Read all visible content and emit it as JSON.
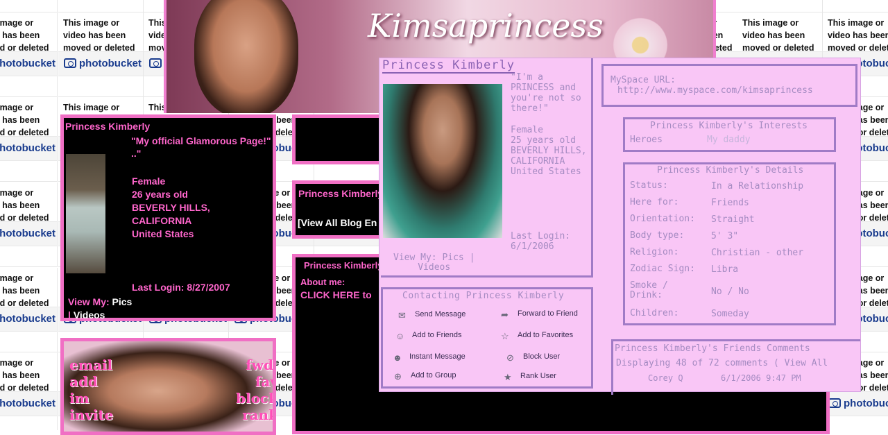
{
  "background": {
    "tile_text": "This image or video has been moved or deleted",
    "logo_text": "photobucket"
  },
  "banner": {
    "title": "Kimsaprincess"
  },
  "left_profile": {
    "name": "Princess Kimberly",
    "quote": "\"My official Glamorous Page!\"",
    "quote_extra": "..\"",
    "gender": "Female",
    "age": "26 years old",
    "city": "BEVERLY HILLS,",
    "state": "CALIFORNIA",
    "country": "United States",
    "last_login": "Last Login: 8/27/2007",
    "view_my": "View My:",
    "pics": "Pics",
    "videos": "Videos"
  },
  "collage": {
    "left_words": [
      "email",
      "add",
      "im",
      "invite"
    ],
    "right_words": [
      "fwd.",
      "fav",
      "block",
      "rank"
    ]
  },
  "mid": {
    "blog_name": "Princess Kimberly",
    "view_blog": "[View All Blog En",
    "about_name": "Princess Kimberly'",
    "about_me": "About me:",
    "click_here": "CLICK HERE to"
  },
  "panel": {
    "name": "Princess Kimberly",
    "quote": "\"I'm a PRINCESS and you're not so there!\"",
    "gender": "Female",
    "age": "25 years old",
    "location": "BEVERLY HILLS, CALIFORNIA United States",
    "last_login_label": "Last Login:",
    "last_login_date": "6/1/2006",
    "view_my": "View My: Pics |",
    "videos": "Videos",
    "myspace_url_label": "MySpace URL:",
    "myspace_url": "http://www.myspace.com/kimsaprincess",
    "contact_header": "Contacting Princess Kimberly",
    "actions": {
      "send_message": "Send Message",
      "forward": "Forward to Friend",
      "add_friends": "Add to Friends",
      "add_favorites": "Add to Favorites",
      "instant_message": "Instant Message",
      "block_user": "Block User",
      "add_group": "Add to Group",
      "rank_user": "Rank User"
    },
    "interests_header": "Princess Kimberly's Interests",
    "heroes_label": "Heroes",
    "heroes_value": "My daddy",
    "details_header": "Princess Kimberly's Details",
    "details": [
      {
        "k": "Status:",
        "v": "In a Relationship"
      },
      {
        "k": "Here for:",
        "v": "Friends"
      },
      {
        "k": "Orientation:",
        "v": "Straight"
      },
      {
        "k": "Body type:",
        "v": "5' 3\""
      },
      {
        "k": "Religion:",
        "v": "Christian - other"
      },
      {
        "k": "Zodiac Sign:",
        "v": "Libra"
      },
      {
        "k": "Smoke / Drink:",
        "v": "No / No"
      },
      {
        "k": "Children:",
        "v": "Someday"
      }
    ],
    "friends_header": "Princess Kimberly's Friends Comments",
    "displaying": "Displaying 48 of 72 comments  ( View All",
    "comment_author": "Corey Q",
    "comment_date": "6/1/2006 9:47 PM"
  }
}
